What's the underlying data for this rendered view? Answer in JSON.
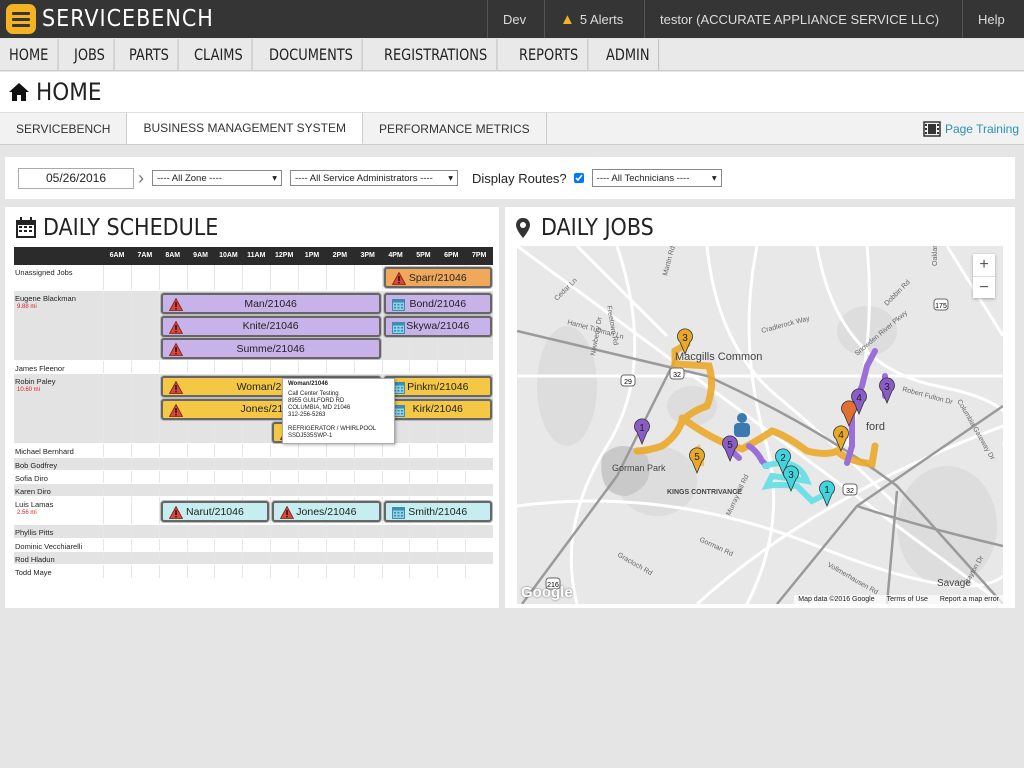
{
  "app": {
    "name": "SERVICEBENCH",
    "env": "Dev",
    "alerts": "5 Alerts",
    "user": "testor (ACCURATE APPLIANCE SERVICE LLC)",
    "help": "Help"
  },
  "nav": [
    "HOME",
    "JOBS",
    "PARTS",
    "CLAIMS",
    "DOCUMENTS",
    "REGISTRATIONS",
    "REPORTS",
    "ADMIN"
  ],
  "page": {
    "title": "HOME"
  },
  "tabs": [
    {
      "label": "SERVICEBENCH"
    },
    {
      "label": "BUSINESS MANAGEMENT SYSTEM",
      "active": true
    },
    {
      "label": "PERFORMANCE METRICS"
    }
  ],
  "training": "Page Training",
  "filters": {
    "date": "05/26/2016",
    "zone": "---- All Zone ----",
    "admins": "---- All Service Administrators ----",
    "display_routes_label": "Display Routes?",
    "display_routes": true,
    "technicians": "---- All Technicians ----"
  },
  "schedule": {
    "title": "DAILY SCHEDULE",
    "hours": [
      "6AM",
      "7AM",
      "8AM",
      "9AM",
      "10AM",
      "11AM",
      "12PM",
      "1PM",
      "2PM",
      "3PM",
      "4PM",
      "5PM",
      "6PM",
      "7PM"
    ],
    "rows": [
      {
        "name": "Unassigned Jobs",
        "lanes": 1,
        "jobs": [
          {
            "label": "Sparr/21046",
            "start": 10,
            "end": 14,
            "lane": 0,
            "color": "#f0a85a",
            "icon": "warning"
          }
        ]
      },
      {
        "name": "Eugene Blackman",
        "miles": "9.88 mi",
        "lanes": 3,
        "jobs": [
          {
            "label": "Man/21046",
            "start": 2,
            "end": 10,
            "lane": 0,
            "color": "#c8b2ea",
            "icon": "warning"
          },
          {
            "label": "Knite/21046",
            "start": 2,
            "end": 10,
            "lane": 1,
            "color": "#c8b2ea",
            "icon": "warning"
          },
          {
            "label": "Summe/21046",
            "start": 2,
            "end": 10,
            "lane": 2,
            "color": "#c8b2ea",
            "icon": "warning"
          },
          {
            "label": "Bond/21046",
            "start": 10,
            "end": 14,
            "lane": 0,
            "color": "#c8b2ea",
            "icon": "calendar"
          },
          {
            "label": "Skywa/21046",
            "start": 10,
            "end": 14,
            "lane": 1,
            "color": "#c8b2ea",
            "icon": "calendar"
          }
        ]
      },
      {
        "name": "James Fleenor",
        "lanes": 0,
        "jobs": []
      },
      {
        "name": "Robin Paley",
        "miles": "10.60 mi",
        "lanes": 3,
        "jobs": [
          {
            "label": "Woman/21046",
            "start": 2,
            "end": 10,
            "lane": 0,
            "color": "#f4c744",
            "icon": "warning"
          },
          {
            "label": "Jones/21046",
            "start": 2,
            "end": 10,
            "lane": 1,
            "color": "#f4c744",
            "icon": "warning"
          },
          {
            "label": "",
            "start": 6,
            "end": 7,
            "lane": 2,
            "color": "#f4c744",
            "icon": "warning"
          },
          {
            "label": "Pinkm/21046",
            "start": 10,
            "end": 14,
            "lane": 0,
            "color": "#f4c744",
            "icon": "calendar"
          },
          {
            "label": "Kirk/21046",
            "start": 10,
            "end": 14,
            "lane": 1,
            "color": "#f4c744",
            "icon": "calendar"
          }
        ]
      },
      {
        "name": "Michael Bernhard",
        "lanes": 0,
        "jobs": []
      },
      {
        "name": "Bob Godfrey",
        "lanes": 0,
        "jobs": []
      },
      {
        "name": "Sofia Diro",
        "lanes": 0,
        "jobs": []
      },
      {
        "name": "Karen Diro",
        "lanes": 0,
        "jobs": []
      },
      {
        "name": "Luis Lamas",
        "miles": "2.56 mi",
        "lanes": 1,
        "tall": true,
        "jobs": [
          {
            "label": "Narut/21046",
            "start": 2,
            "end": 6,
            "lane": 0,
            "color": "#c6eef0",
            "icon": "warning"
          },
          {
            "label": "Jones/21046",
            "start": 6,
            "end": 10,
            "lane": 0,
            "color": "#c6eef0",
            "icon": "warning"
          },
          {
            "label": "Smith/21046",
            "start": 10,
            "end": 14,
            "lane": 0,
            "color": "#c6eef0",
            "icon": "calendar"
          }
        ]
      },
      {
        "name": "Phyllis Pitts",
        "lanes": 0,
        "jobs": []
      },
      {
        "name": "Dominic Vecchiarelli",
        "lanes": 0,
        "jobs": []
      },
      {
        "name": "Rod Hladun",
        "lanes": 0,
        "jobs": []
      },
      {
        "name": "Todd Maye",
        "lanes": 0,
        "jobs": []
      }
    ],
    "tooltip": {
      "title": "Woman/21046",
      "lines": [
        "Call Center Testing",
        "8955 GUILFORD RD",
        "COLUMBIA, MD 21046",
        "312-256-5263",
        "",
        "REFRIGERATOR / WHIRLPOOL",
        "SSDJ535SWP-1"
      ]
    }
  },
  "map": {
    "title": "DAILY JOBS",
    "zoom_in": "+",
    "zoom_out": "−",
    "attribution": "Map data ©2016 Google",
    "terms": "Terms of Use",
    "report": "Report a map error",
    "logo": "Google",
    "labels": [
      "Macgills Common",
      "Gorman Park",
      "KINGS CONTRIVANCE",
      "Savage",
      "ford",
      "Cedar Ln",
      "Freetown Rd",
      "Martin Rd",
      "Harriet Tubman Ln",
      "Cradlerock Way",
      "Dobbin Rd",
      "Newberry Dr",
      "Murray Hill Rd",
      "Gorman Rd",
      "Gracloch Rd",
      "Vollmerhausen Rd",
      "Oakland Mills Rd",
      "Snowden River Pkwy",
      "Robert Fulton Dr",
      "Columbia Gateway Dr",
      "Stayton Dr"
    ],
    "shields": [
      "29",
      "32",
      "32",
      "175",
      "216"
    ],
    "markers": [
      {
        "n": "3",
        "color": "#e8a92a",
        "route": "yellow"
      },
      {
        "n": "1",
        "color": "#8a5cc8",
        "route": "purple"
      },
      {
        "n": "5",
        "color": "#e8a92a",
        "route": "yellow"
      },
      {
        "n": "5",
        "color": "#8a5cc8",
        "route": "purple"
      },
      {
        "n": "2",
        "color": "#40d4dc",
        "route": "cyan"
      },
      {
        "n": "3",
        "color": "#40d4dc",
        "route": "cyan"
      },
      {
        "n": "1",
        "color": "#40d4dc",
        "route": "cyan"
      },
      {
        "n": "4",
        "color": "#e8a92a",
        "route": "yellow"
      },
      {
        "n": "",
        "color": "#e07030",
        "route": "unassigned"
      },
      {
        "n": "4",
        "color": "#8a5cc8",
        "route": "purple"
      },
      {
        "n": "3",
        "color": "#8a5cc8",
        "route": "purple"
      }
    ]
  }
}
